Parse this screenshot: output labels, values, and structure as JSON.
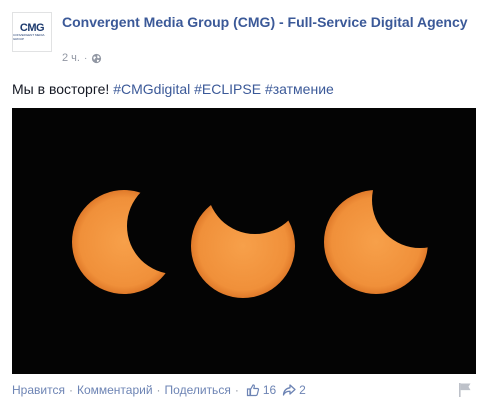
{
  "post": {
    "page_name": "Convergent Media Group (CMG) - Full-Service Digital Agency",
    "avatar": {
      "logo_main": "CMG",
      "logo_sub": "convergent media group"
    },
    "time": "2 ч.",
    "text_prefix": "Мы в восторге!",
    "hashtags": [
      "#CMGdigital",
      "#ECLIPSE",
      "#затмение"
    ],
    "image": {
      "subject": "three partial solar eclipse phases on black sky",
      "colors": {
        "sky": "#040404",
        "sun": "#f0903a"
      }
    }
  },
  "actions": {
    "like": "Нравится",
    "comment": "Комментарий",
    "share": "Поделиться",
    "likes_count": "16",
    "shares_count": "2"
  },
  "colors": {
    "link": "#3b5998",
    "muted": "#9197a3",
    "action": "#6d84b4"
  }
}
